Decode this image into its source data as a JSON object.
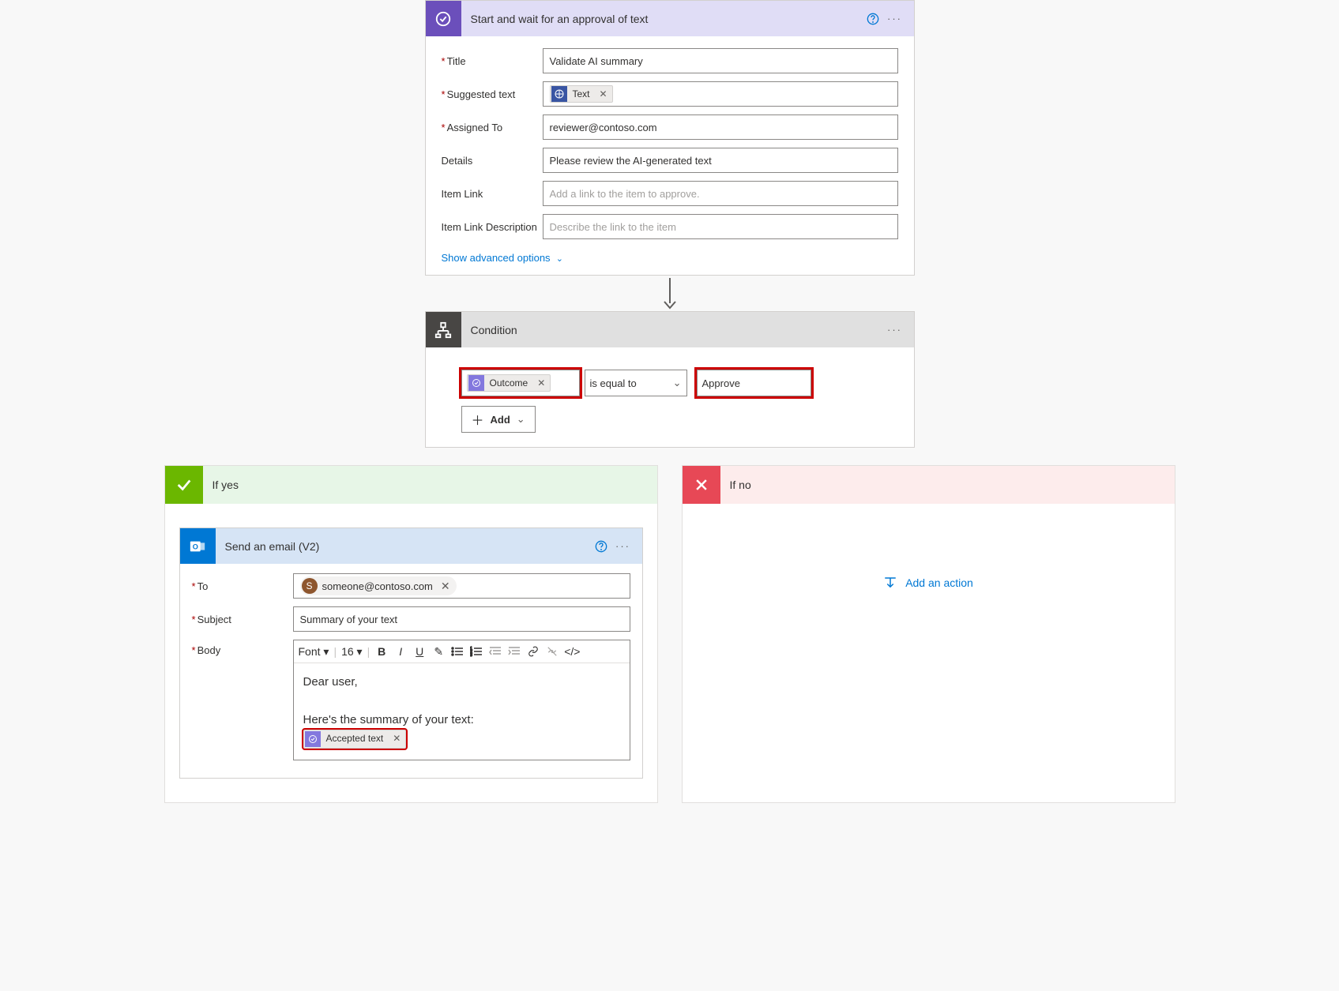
{
  "approval_step": {
    "title": "Start and wait for an approval of text",
    "fields": {
      "title": {
        "label": "Title",
        "value": "Validate AI summary"
      },
      "suggested_text": {
        "label": "Suggested text",
        "token": "Text"
      },
      "assigned_to": {
        "label": "Assigned To",
        "value": "reviewer@contoso.com"
      },
      "details": {
        "label": "Details",
        "value": "Please review the AI-generated text"
      },
      "item_link": {
        "label": "Item Link",
        "placeholder": "Add a link to the item to approve."
      },
      "item_link_desc": {
        "label": "Item Link Description",
        "placeholder": "Describe the link to the item"
      }
    },
    "advanced_toggle": "Show advanced options"
  },
  "condition_step": {
    "title": "Condition",
    "left_token": "Outcome",
    "operator": "is equal to",
    "right_value": "Approve",
    "add_label": "Add"
  },
  "yes_branch": {
    "title": "If yes",
    "email_step": {
      "title": "Send an email (V2)",
      "to": {
        "label": "To",
        "address": "someone@contoso.com",
        "initial": "S"
      },
      "subject": {
        "label": "Subject",
        "value": "Summary of your text"
      },
      "body": {
        "label": "Body",
        "font_label": "Font",
        "size_label": "16",
        "line1": "Dear user,",
        "line2": "Here's the summary of your text:",
        "token": "Accepted text"
      }
    }
  },
  "no_branch": {
    "title": "If no",
    "add_action": "Add an action"
  }
}
